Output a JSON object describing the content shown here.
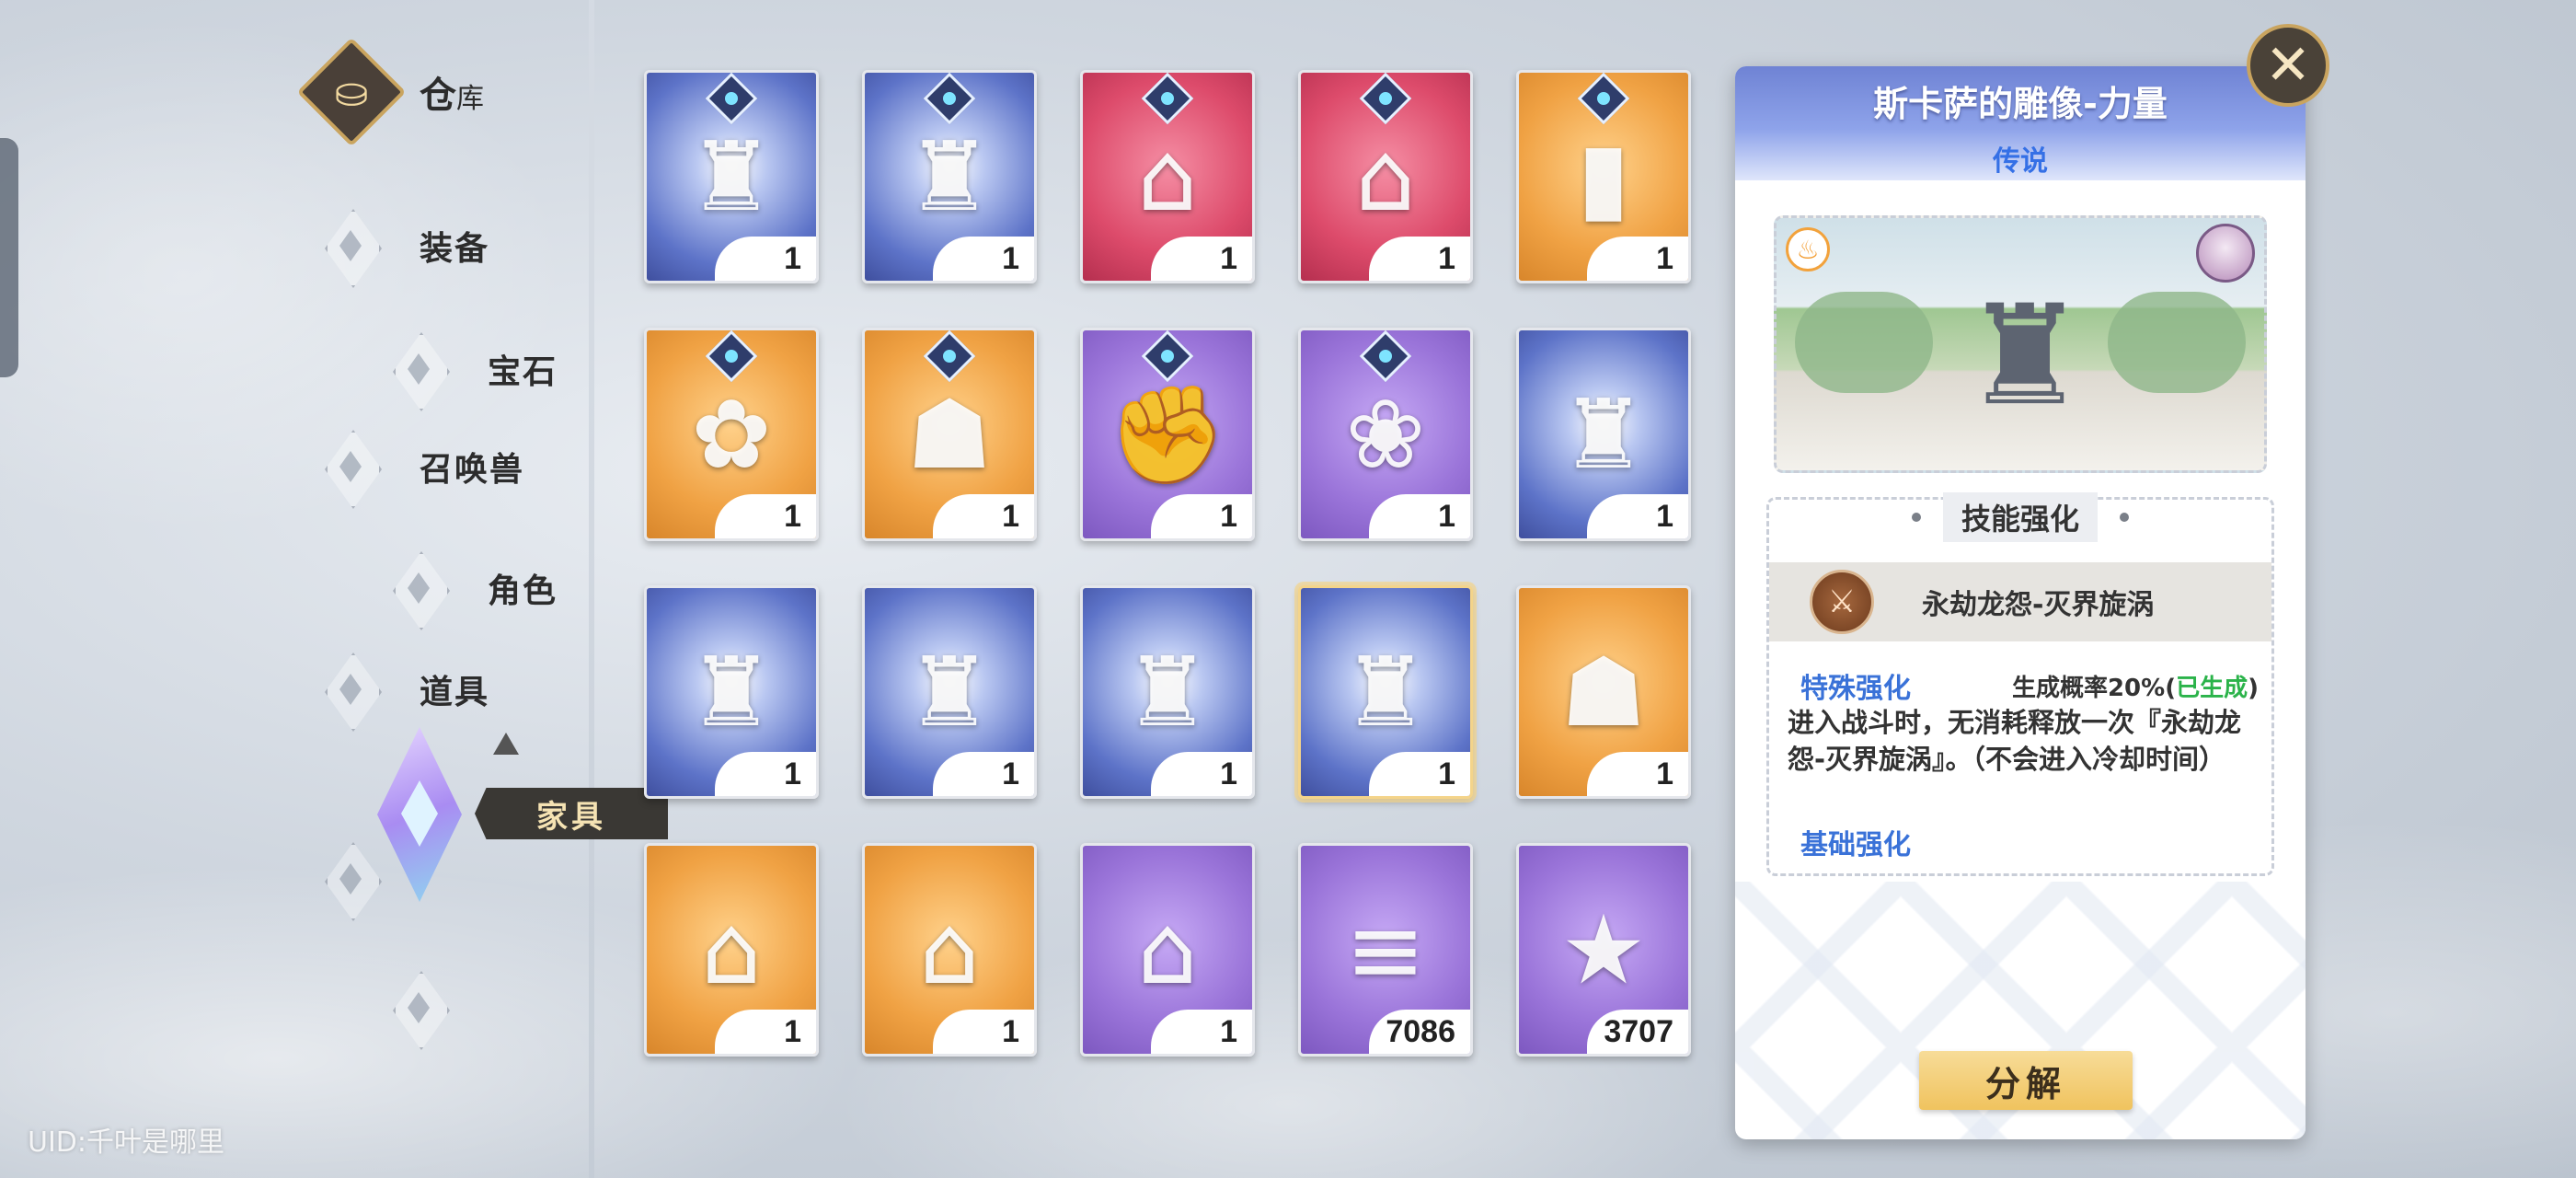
{
  "sidebar": {
    "title": "仓",
    "title_small": "库",
    "items": [
      {
        "label": "装备"
      },
      {
        "label": "宝石"
      },
      {
        "label": "召唤兽"
      },
      {
        "label": "角色"
      },
      {
        "label": "道具"
      },
      {
        "label": "家具"
      }
    ],
    "active_index": 5
  },
  "uid": "UID:千叶是哪里",
  "grid": [
    {
      "name": "statue-blue-orange",
      "color": "blue",
      "gem": true,
      "count": "1",
      "icon": "statue-icon"
    },
    {
      "name": "statue-blue-gold",
      "color": "blue",
      "gem": true,
      "count": "1",
      "icon": "statue-icon"
    },
    {
      "name": "mansion-red",
      "color": "red",
      "gem": true,
      "count": "1",
      "icon": "building-icon"
    },
    {
      "name": "mansion-red-2",
      "color": "red",
      "gem": true,
      "count": "1",
      "icon": "building-icon"
    },
    {
      "name": "obelisk",
      "color": "orange",
      "gem": true,
      "count": "1",
      "icon": "obelisk-icon"
    },
    {
      "name": "flower-fence",
      "color": "orange",
      "gem": true,
      "count": "1",
      "icon": "flower-icon"
    },
    {
      "name": "oni-board",
      "color": "orange",
      "gem": true,
      "count": "1",
      "icon": "mask-icon"
    },
    {
      "name": "fist-statue",
      "color": "purple",
      "gem": true,
      "count": "1",
      "icon": "fist-icon"
    },
    {
      "name": "flower-planter",
      "color": "purple",
      "gem": true,
      "count": "1",
      "icon": "planter-icon"
    },
    {
      "name": "statue-blue-ice",
      "color": "blue",
      "gem": false,
      "count": "1",
      "icon": "statue-icon"
    },
    {
      "name": "statue-witch-orange",
      "color": "blue",
      "gem": false,
      "count": "1",
      "icon": "statue-icon"
    },
    {
      "name": "statue-witch-red",
      "color": "blue",
      "gem": false,
      "count": "1",
      "icon": "statue-icon"
    },
    {
      "name": "statue-armor-gold",
      "color": "blue",
      "gem": false,
      "count": "1",
      "icon": "statue-icon"
    },
    {
      "name": "statue-skadi-selected",
      "color": "blue",
      "gem": false,
      "count": "1",
      "icon": "statue-icon",
      "selected": true
    },
    {
      "name": "oni-board-2",
      "color": "orange",
      "gem": false,
      "count": "1",
      "icon": "mask-icon"
    },
    {
      "name": "flower-shop",
      "color": "orange",
      "gem": false,
      "count": "1",
      "icon": "shop-icon"
    },
    {
      "name": "flower-shop-2",
      "color": "orange",
      "gem": false,
      "count": "1",
      "icon": "shop-icon"
    },
    {
      "name": "bakery",
      "color": "purple",
      "gem": false,
      "count": "1",
      "icon": "bakery-icon"
    },
    {
      "name": "logs",
      "color": "purple",
      "gem": false,
      "count": "7086",
      "icon": "log-icon"
    },
    {
      "name": "star-crystal",
      "color": "purple",
      "gem": false,
      "count": "3707",
      "icon": "star-icon"
    }
  ],
  "icon_glyphs": {
    "statue-icon": "♜",
    "building-icon": "⌂",
    "obelisk-icon": "▮",
    "flower-icon": "✿",
    "mask-icon": "☗",
    "fist-icon": "✊",
    "planter-icon": "❀",
    "shop-icon": "⌂",
    "bakery-icon": "⌂",
    "log-icon": "≡",
    "star-icon": "★"
  },
  "detail": {
    "title": "斯卡萨的雕像-力量",
    "rarity": "传说",
    "skill_section_title": "技能强化",
    "skill_name": "永劫龙怨-灭界旋涡",
    "special_label": "特殊强化",
    "special_status_prefix": "生成概率20%(",
    "special_status_value": "已生成",
    "special_status_suffix": ")",
    "special_desc": "进入战斗时，无消耗释放一次『永劫龙怨-灭界旋涡』。（不会进入冷却时间）",
    "basic_label": "基础强化",
    "decompose_label": "分解",
    "close_label": "✕"
  },
  "colors": {
    "accent_blue": "#3a72d8",
    "status_green": "#2bb34a",
    "button_gold": "#f0c35e"
  }
}
